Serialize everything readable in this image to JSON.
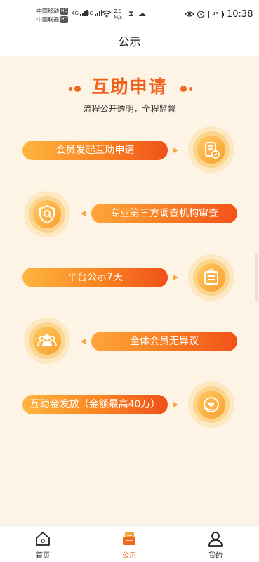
{
  "status_bar": {
    "carrier_1": "中国移动",
    "carrier_2": "中国联通",
    "hd": "HD",
    "net_1": "4G",
    "net_2": "4G",
    "speed_value": "2.9",
    "speed_unit": "M/s",
    "battery": "43",
    "time": "10:38"
  },
  "header": {
    "title": "公示"
  },
  "main": {
    "title": "互助申请",
    "subtitle": "流程公开透明，全程监督",
    "steps": [
      {
        "label": "会员发起互助申请",
        "icon": "document-edit-icon"
      },
      {
        "label": "专业第三方调查机构审查",
        "icon": "shield-search-icon"
      },
      {
        "label": "平台公示7天",
        "icon": "notice-board-icon"
      },
      {
        "label": "全体会员无异议",
        "icon": "members-group-icon"
      },
      {
        "label": "互助金发放（金额最高40万）",
        "icon": "heart-hand-icon"
      }
    ]
  },
  "colors": {
    "accent": "#f06a1e",
    "background": "#fdf4e5",
    "icon_fill": "#f8a12e"
  },
  "tabbar": {
    "items": [
      {
        "label": "首页",
        "icon": "home-icon",
        "active": false
      },
      {
        "label": "公示",
        "icon": "notice-icon",
        "active": true
      },
      {
        "label": "我的",
        "icon": "profile-icon",
        "active": false
      }
    ]
  }
}
